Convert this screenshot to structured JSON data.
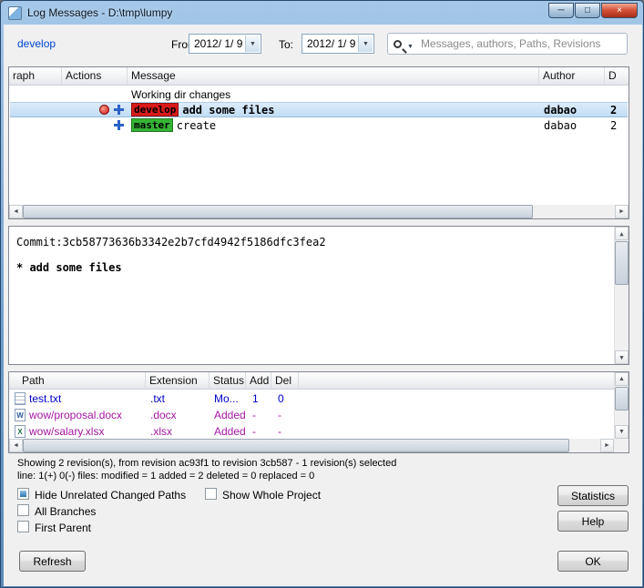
{
  "window": {
    "title": "Log Messages - D:\\tmp\\lumpy",
    "controls": {
      "minimize": "─",
      "maximize": "□",
      "close": "×"
    }
  },
  "icons": {
    "dropdown": "▼",
    "scroll_left": "◄",
    "scroll_right": "►",
    "scroll_up": "▲",
    "scroll_down": "▼"
  },
  "toolbar": {
    "branch_link": "develop",
    "from_label": "From:",
    "from_value": "2012/ 1/ 9",
    "to_label": "To:",
    "to_value": "2012/ 1/ 9",
    "search_placeholder": "Messages, authors, Paths, Revisions"
  },
  "log_list": {
    "columns": {
      "graph": "raph",
      "actions": "Actions",
      "message": "Message",
      "author": "Author",
      "date": "D"
    },
    "rows": [
      {
        "message": "Working dir changes",
        "author": "",
        "date": ""
      },
      {
        "badge": "develop",
        "message": "add some files",
        "author": "dabao",
        "date": "2",
        "selected": true,
        "actions": [
          "modified",
          "added"
        ]
      },
      {
        "badge": "master",
        "message": "create",
        "author": "dabao",
        "date": "2",
        "selected": false,
        "actions": [
          "added"
        ]
      }
    ]
  },
  "commit_panel": {
    "commit_line": "Commit:3cb58773636b3342e2b7cfd4942f5186dfc3fea2",
    "message_line": "* add some files"
  },
  "file_list": {
    "columns": {
      "path": "Path",
      "extension": "Extension",
      "status": "Status",
      "add": "Add",
      "del": "Del"
    },
    "rows": [
      {
        "path": "test.txt",
        "extension": ".txt",
        "status": "Mo...",
        "add": "1",
        "del": "0"
      },
      {
        "path": "wow/proposal.docx",
        "extension": ".docx",
        "status": "Added",
        "add": "-",
        "del": "-"
      },
      {
        "path": "wow/salary.xlsx",
        "extension": ".xlsx",
        "status": "Added",
        "add": "-",
        "del": "-"
      }
    ]
  },
  "status_bar": {
    "line1": "Showing 2 revision(s), from revision ac93f1 to revision 3cb587 - 1 revision(s) selected",
    "line2": "line: 1(+) 0(-) files: modified = 1 added = 2 deleted = 0 replaced = 0"
  },
  "options": {
    "hide_unrelated": "Hide Unrelated Changed Paths",
    "show_whole_project": "Show Whole Project",
    "all_branches": "All Branches",
    "first_parent": "First Parent"
  },
  "buttons": {
    "statistics": "Statistics",
    "help": "Help",
    "ok": "OK",
    "refresh": "Refresh"
  },
  "colors": {
    "selected_row": "#c2ddf4",
    "develop_badge": "#d91a1a",
    "master_badge": "#35b435",
    "modified_text": "#0000c8",
    "added_text": "#a516a5",
    "link": "#0046d5"
  }
}
